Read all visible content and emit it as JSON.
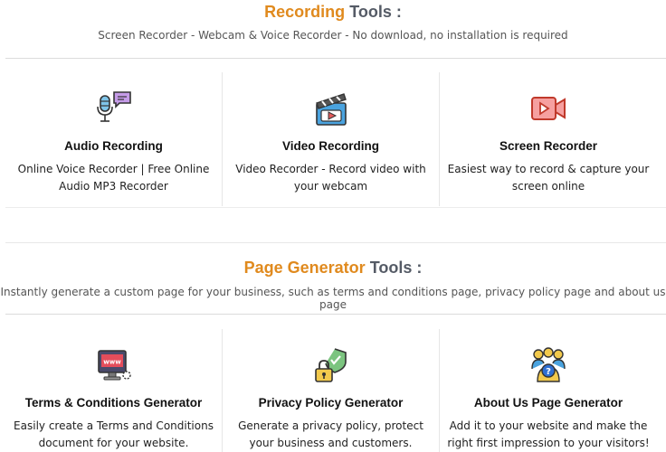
{
  "recording": {
    "title_accent": "Recording",
    "title_rest": "Tools :",
    "subtitle": "Screen Recorder - Webcam & Voice Recorder - No download, no installation is required",
    "cards": [
      {
        "icon": "microphone-chat-icon",
        "title": "Audio Recording",
        "desc": "Online Voice Recorder | Free Online Audio MP3 Recorder"
      },
      {
        "icon": "clapperboard-icon",
        "title": "Video Recording",
        "desc": "Video Recorder - Record video with your webcam"
      },
      {
        "icon": "video-camera-icon",
        "title": "Screen Recorder",
        "desc": "Easiest way to record & capture your screen online"
      }
    ]
  },
  "page_generator": {
    "title_accent": "Page Generator",
    "title_rest": "Tools :",
    "subtitle": "Instantly generate a custom page for your business, such as terms and conditions page, privacy policy page and about us page",
    "cards": [
      {
        "icon": "www-monitor-icon",
        "title": "Terms & Conditions Generator",
        "desc": "Easily create a Terms and Conditions document for your website."
      },
      {
        "icon": "shield-lock-icon",
        "title": "Privacy Policy Generator",
        "desc": "Generate a privacy policy, protect your business and customers."
      },
      {
        "icon": "team-question-icon",
        "title": "About Us Page Generator",
        "desc": "Add it to your website and make the right first impression to your visitors!"
      }
    ]
  },
  "colors": {
    "accent": "#e08a1e",
    "title_gray": "#555b66"
  }
}
